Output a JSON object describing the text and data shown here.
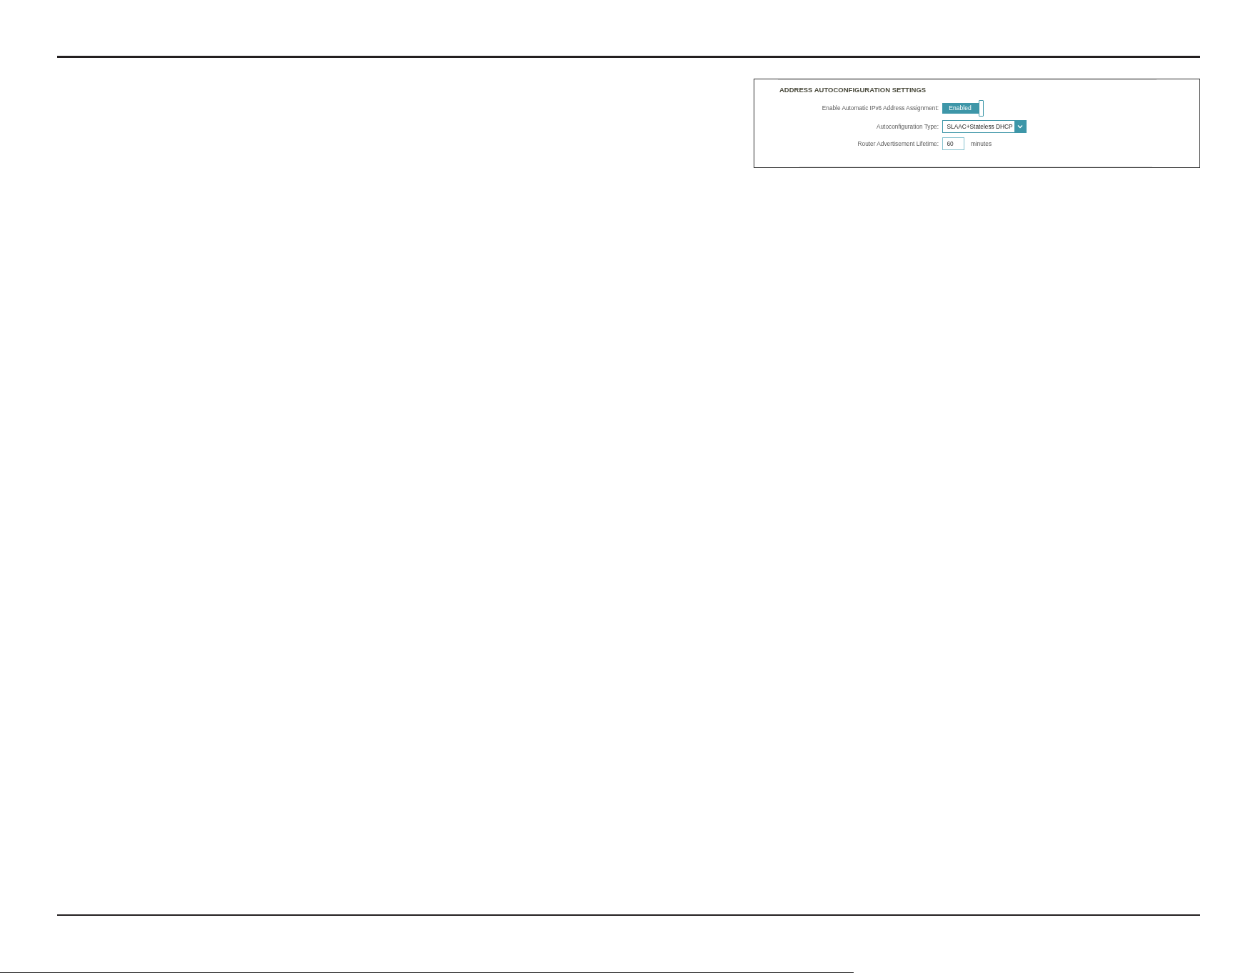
{
  "section": {
    "title": "ADDRESS AUTOCONFIGURATION SETTINGS",
    "fields": [
      {
        "kind": "toggle",
        "label": "Enable Automatic IPv6 Address Assignment:",
        "value": "Enabled",
        "on": true
      },
      {
        "kind": "select",
        "label": "Autoconfiguration Type:",
        "value": "SLAAC+Stateless DHCP"
      },
      {
        "kind": "input",
        "label": "Router Advertisement Lifetime:",
        "value": "60",
        "unit": "minutes"
      }
    ]
  }
}
